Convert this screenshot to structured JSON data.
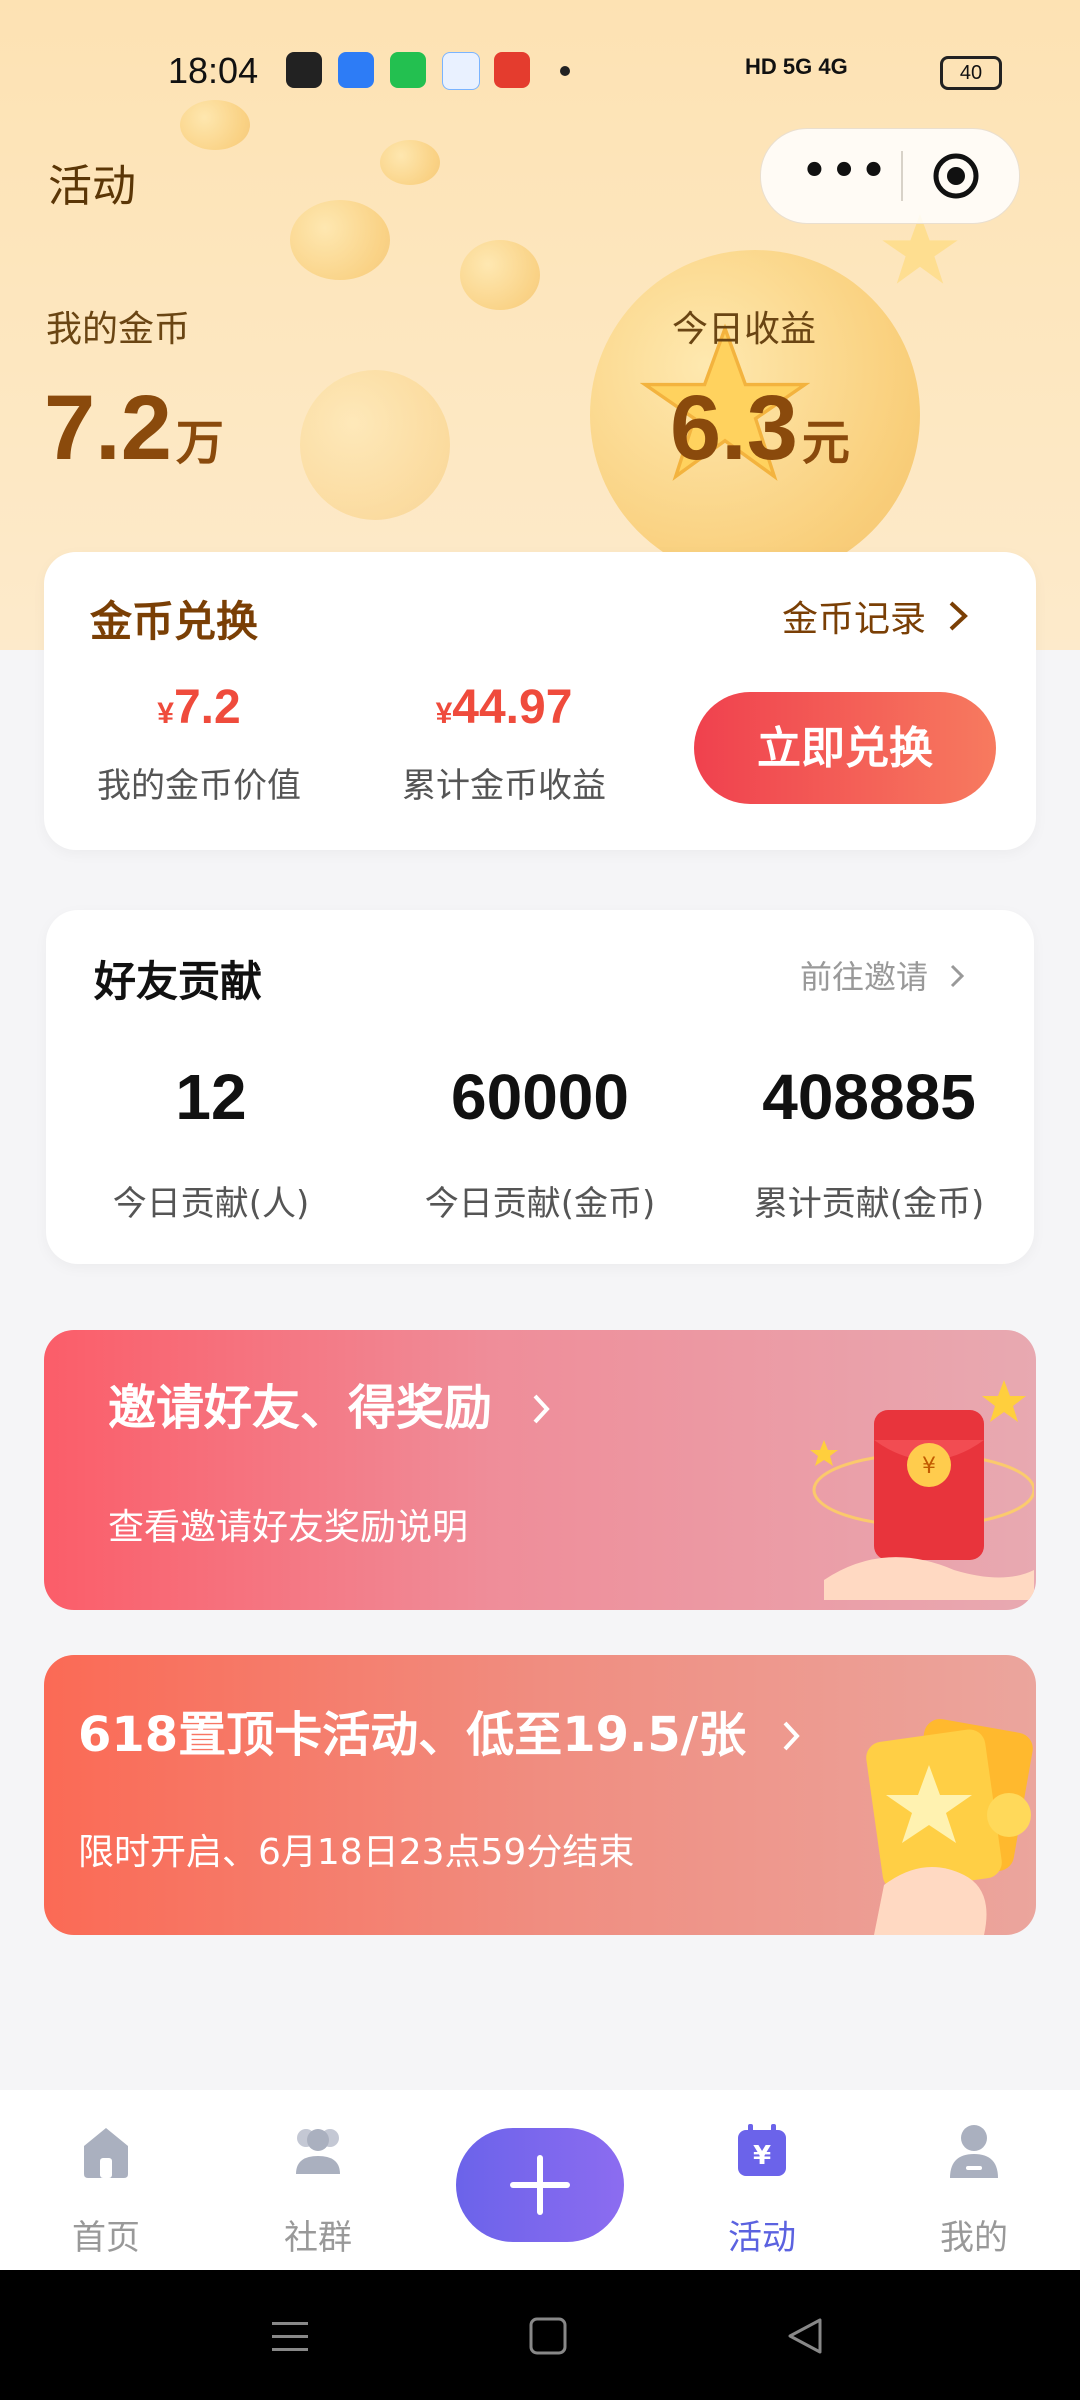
{
  "status_bar": {
    "time": "18:04",
    "network": "HD 5G 4G",
    "battery": "40"
  },
  "header": {
    "title": "活动"
  },
  "capsule": {
    "more_label": "•••"
  },
  "hero": {
    "coins_label": "我的金币",
    "coins_value": "7.2",
    "coins_unit": "万",
    "earnings_label": "今日收益",
    "earnings_value": "6.3",
    "earnings_unit": "元"
  },
  "exchange": {
    "title": "金币兑换",
    "records_link": "金币记录",
    "currency_symbol": "¥",
    "value_amount": "7.2",
    "value_label": "我的金币价值",
    "total_amount": "44.97",
    "total_label": "累计金币收益",
    "button": "立即兑换"
  },
  "friends": {
    "title": "好友贡献",
    "invite_link": "前往邀请",
    "stats": [
      {
        "value": "12",
        "label": "今日贡献(人)"
      },
      {
        "value": "60000",
        "label": "今日贡献(金币)"
      },
      {
        "value": "408885",
        "label": "累计贡献(金币)"
      }
    ]
  },
  "banners": [
    {
      "title": "邀请好友、得奖励",
      "subtitle": "查看邀请好友奖励说明"
    },
    {
      "title": "618置顶卡活动、低至19.5/张",
      "subtitle": "限时开启、6月18日23点59分结束"
    }
  ],
  "tabbar": {
    "items": [
      {
        "label": "首页",
        "icon": "home-icon"
      },
      {
        "label": "社群",
        "icon": "group-icon"
      },
      {
        "label": "",
        "icon": "plus-icon"
      },
      {
        "label": "活动",
        "icon": "activity-calendar-icon",
        "active": true
      },
      {
        "label": "我的",
        "icon": "profile-icon"
      }
    ]
  },
  "colors": {
    "accent": "#5b62e0",
    "exchange_button": "#f0414e",
    "price": "#ef4b3c",
    "hero_text": "#8a4a0c"
  }
}
